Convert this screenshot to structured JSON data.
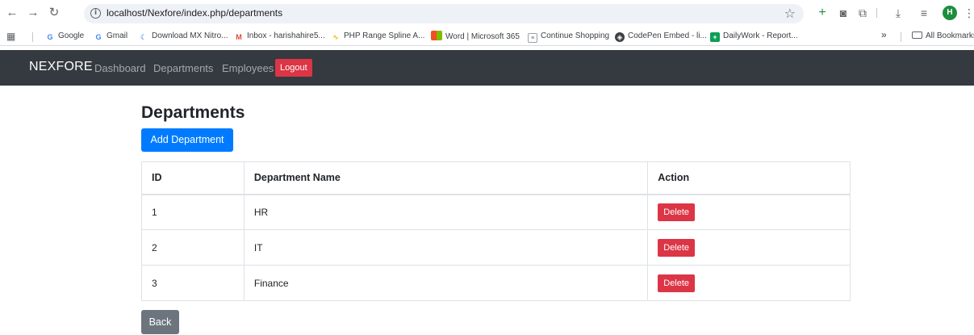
{
  "browser": {
    "url": "localhost/Nexfore/index.php/departments",
    "profile_initial": "H",
    "bookmarks": [
      {
        "label": "Google",
        "color": "#4285f4",
        "glyph": "G"
      },
      {
        "label": "Gmail",
        "color": "#4285f4",
        "glyph": "G"
      },
      {
        "label": "Download MX Nitro...",
        "color": "#1a73e8",
        "glyph": "C"
      },
      {
        "label": "Inbox - harishahire5...",
        "color": "#ea4335",
        "glyph": "M"
      },
      {
        "label": "PHP Range Spline A...",
        "color": "#f4b400",
        "glyph": "~"
      },
      {
        "label": "Word | Microsoft 365",
        "color": "#f25022",
        "glyph": "W"
      },
      {
        "label": "Continue Shopping",
        "color": "#5f6368",
        "glyph": "="
      },
      {
        "label": "CodePen Embed - li...",
        "color": "#202124",
        "glyph": "C"
      },
      {
        "label": "DailyWork - Report...",
        "color": "#0f9d58",
        "glyph": "+"
      }
    ],
    "overflow_label": "»",
    "all_bookmarks_label": "All Bookmarks"
  },
  "navbar": {
    "brand": "NEXFORE",
    "links": [
      "Dashboard",
      "Departments",
      "Employees"
    ],
    "logout_label": "Logout",
    "bg_color": "#343a40"
  },
  "page": {
    "title": "Departments",
    "add_button_label": "Add Department",
    "back_button_label": "Back"
  },
  "table": {
    "headers": [
      "ID",
      "Department Name",
      "Action"
    ],
    "rows": [
      {
        "id": "1",
        "name": "HR",
        "action": "Delete"
      },
      {
        "id": "2",
        "name": "IT",
        "action": "Delete"
      },
      {
        "id": "3",
        "name": "Finance",
        "action": "Delete"
      }
    ]
  },
  "colors": {
    "primary": "#007bff",
    "danger": "#dc3545",
    "secondary": "#6c757d"
  }
}
